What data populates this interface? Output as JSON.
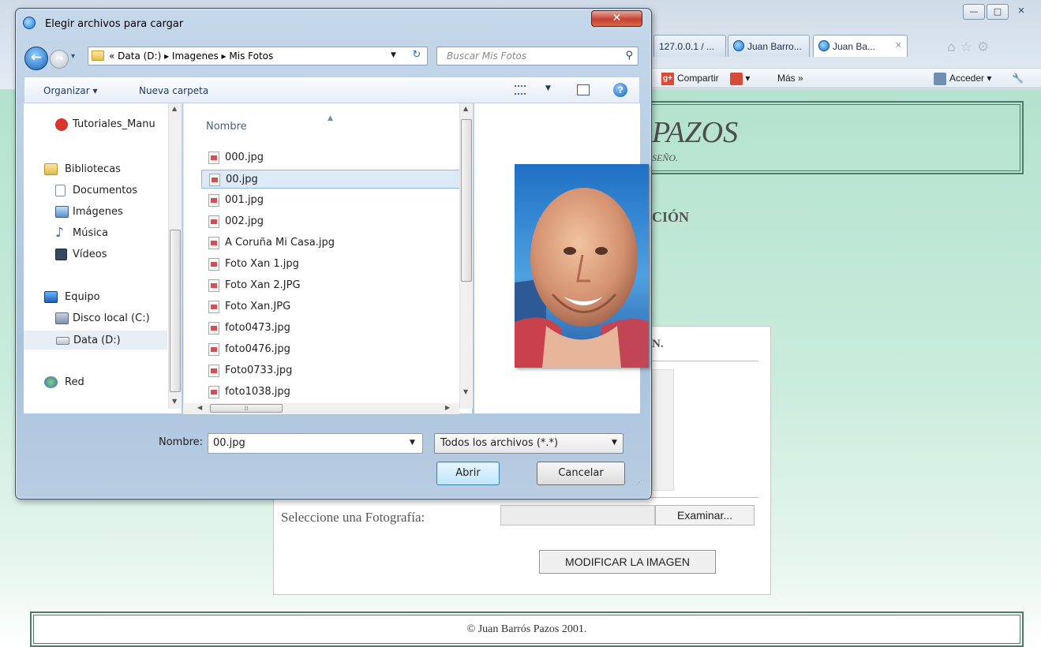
{
  "browser": {
    "tabs": [
      {
        "label": "127.0.0.1 / ..."
      },
      {
        "label": "Juan Barro..."
      },
      {
        "label": "Juan Ba...",
        "active": true
      }
    ],
    "commandbar": {
      "share_label": "Compartir",
      "more_label": "Más »",
      "login_label": "Acceder ▾"
    },
    "window_controls": {
      "minimize": "—",
      "maximize": "□",
      "close": "✕"
    }
  },
  "page": {
    "header_title": "PAZOS",
    "header_subtitle": "SEÑO.",
    "section_heading": "CIÓN",
    "panel_title": "N.",
    "select_photo_label": "Seleccione una Fotografía:",
    "browse_button": "Examinar...",
    "modify_button": "MODIFICAR LA IMAGEN",
    "footer": "© Juan Barrós Pazos 2001."
  },
  "dialog": {
    "title": "Elegir archivos para cargar",
    "close_symbol": "✕",
    "address": {
      "crumbs": "« Data (D:)  ▸  Imagenes  ▸  Mis Fotos"
    },
    "search_placeholder": "Buscar Mis Fotos",
    "toolbar": {
      "organize": "Organizar ▾",
      "new_folder": "Nueva carpeta",
      "help": "?"
    },
    "nav_items": [
      {
        "label": "Tutoriales_Manu",
        "icon": "tutoriales-icon"
      },
      {
        "label": "Bibliotecas",
        "icon": "libraries-icon"
      },
      {
        "label": "Documentos",
        "icon": "documents-icon"
      },
      {
        "label": "Imágenes",
        "icon": "pictures-icon"
      },
      {
        "label": "Música",
        "icon": "music-icon"
      },
      {
        "label": "Vídeos",
        "icon": "videos-icon"
      },
      {
        "label": "Equipo",
        "icon": "computer-icon"
      },
      {
        "label": "Disco local (C:)",
        "icon": "local-disk-icon"
      },
      {
        "label": "Data (D:)",
        "icon": "drive-icon",
        "selected": true
      },
      {
        "label": "Red",
        "icon": "network-icon"
      }
    ],
    "column_header": "Nombre",
    "files": [
      "000.jpg",
      "00.jpg",
      "001.jpg",
      "002.jpg",
      "A Coruña Mi Casa.jpg",
      "Foto Xan 1.jpg",
      "Foto Xan 2.JPG",
      "Foto Xan.JPG",
      "foto0473.jpg",
      "foto0476.jpg",
      "Foto0733.jpg",
      "foto1038.jpg"
    ],
    "selected_file": "00.jpg",
    "filename_label": "Nombre:",
    "filename_value": "00.jpg",
    "filter_value": "Todos los archivos (*.*)",
    "open_button": "Abrir",
    "cancel_button": "Cancelar"
  }
}
